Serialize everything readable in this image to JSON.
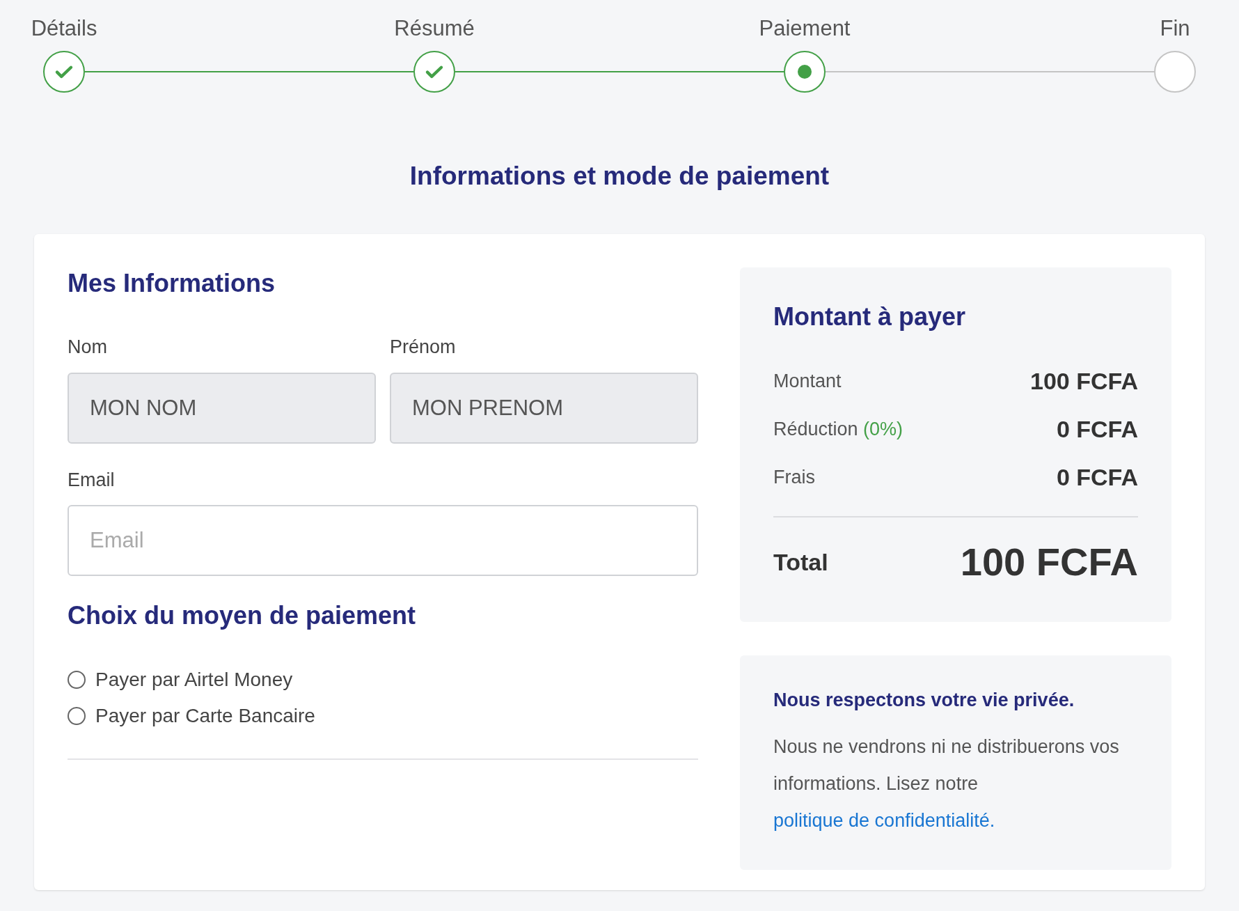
{
  "steps": [
    {
      "label": "Détails",
      "kind": "done"
    },
    {
      "label": "Résumé",
      "kind": "done"
    },
    {
      "label": "Paiement",
      "kind": "current"
    },
    {
      "label": "Fin",
      "kind": "todo"
    }
  ],
  "title": "Informations et mode de paiement",
  "form": {
    "heading": "Mes Informations",
    "fields": [
      {
        "label": "Nom",
        "value": "MON NOM",
        "disabled": true
      },
      {
        "label": "Prénom",
        "value": "MON PRENOM",
        "disabled": true
      }
    ],
    "email": {
      "label": "Email",
      "placeholder": "Email"
    },
    "payment_heading": "Choix du moyen de paiement",
    "payment_options": [
      {
        "label": "Payer par Airtel Money",
        "selected": false
      },
      {
        "label": "Payer par Carte Bancaire",
        "selected": false
      }
    ]
  },
  "summary": {
    "heading": "Montant à payer",
    "rows": [
      {
        "label": "Montant",
        "value": "100 FCFA"
      },
      {
        "label": "Réduction",
        "note": "(0%)",
        "value": "0 FCFA"
      },
      {
        "label": "Frais",
        "value": "0 FCFA"
      }
    ],
    "total_label": "Total",
    "total_value": "100 FCFA"
  },
  "privacy": {
    "heading": "Nous respectons votre vie privée.",
    "text": "Nous ne vendrons ni ne distribuerons vos informations. Lisez notre",
    "link": "politique de confidentialité."
  }
}
